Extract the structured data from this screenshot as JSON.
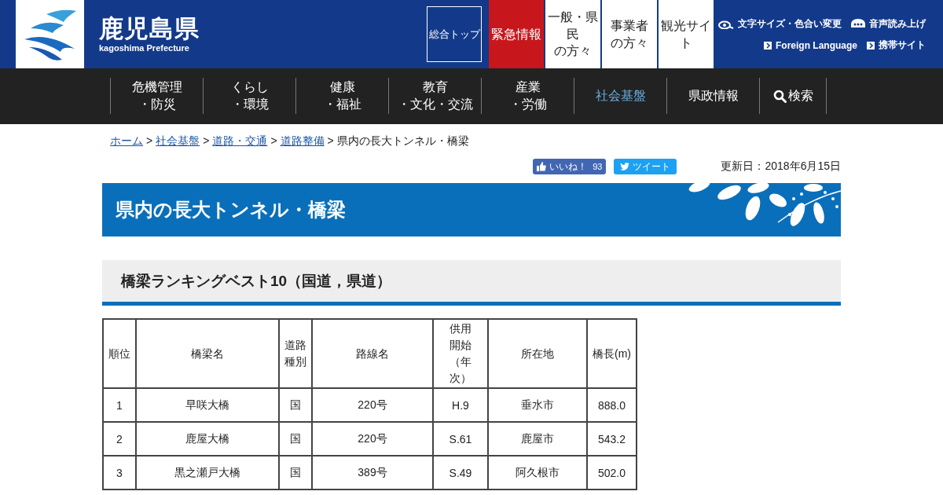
{
  "header": {
    "logo_title": "鹿児島県",
    "logo_subtitle": "kagoshima Prefecture",
    "buttons": [
      {
        "kind": "outline",
        "lines": [
          "総合トップ"
        ]
      },
      {
        "kind": "emergency",
        "lines": [
          "緊急情報"
        ]
      },
      {
        "kind": "white",
        "lines": [
          "一般・県",
          "民",
          "の方々"
        ]
      },
      {
        "kind": "white",
        "lines": [
          "事業者",
          "の方々"
        ]
      },
      {
        "kind": "white",
        "lines": [
          "観光サイ",
          "ト"
        ]
      }
    ],
    "tools": [
      {
        "kind": "eye",
        "label": "文字サイズ・色合い変更"
      },
      {
        "kind": "speech",
        "label": "音声読み上げ"
      }
    ],
    "links": [
      "Foreign Language",
      "携帯サイト"
    ]
  },
  "nav": [
    {
      "lines": [
        "危機管理",
        "・防災"
      ],
      "selected": false
    },
    {
      "lines": [
        "くらし",
        "・環境"
      ],
      "selected": false
    },
    {
      "lines": [
        "健康",
        "・福祉"
      ],
      "selected": false
    },
    {
      "lines": [
        "教育",
        "・文化・交流"
      ],
      "selected": false
    },
    {
      "lines": [
        "産業",
        "・労働"
      ],
      "selected": false
    },
    {
      "lines": [
        "社会基盤"
      ],
      "selected": true
    },
    {
      "lines": [
        "県政情報"
      ],
      "selected": false
    },
    {
      "lines": [
        "検索"
      ],
      "selected": false,
      "kind": "search"
    }
  ],
  "breadcrumb": {
    "separator": ">",
    "links": [
      "ホーム",
      "社会基盤",
      "道路・交通",
      "道路整備"
    ],
    "current": "県内の長大トンネル・橋梁"
  },
  "social": {
    "like_label": "いいね！",
    "like_count": "93",
    "tweet_label": "ツイート"
  },
  "updated": "更新日：2018年6月15日",
  "page_title": "県内の長大トンネル・橋梁",
  "section_title": "橋梁ランキングベスト10（国道，県道）",
  "table": {
    "columns": [
      "順位",
      "橋梁名",
      "道路種別",
      "路線名",
      "供用開始（年次）",
      "所在地",
      "橋長(m)"
    ],
    "rows": [
      [
        "1",
        "早咲大橋",
        "国",
        "220号",
        "H.9",
        "垂水市",
        "888.0"
      ],
      [
        "2",
        "鹿屋大橋",
        "国",
        "220号",
        "S.61",
        "鹿屋市",
        "543.2"
      ],
      [
        "3",
        "黒之瀬戸大橋",
        "国",
        "389号",
        "S.49",
        "阿久根市",
        "502.0"
      ]
    ]
  }
}
